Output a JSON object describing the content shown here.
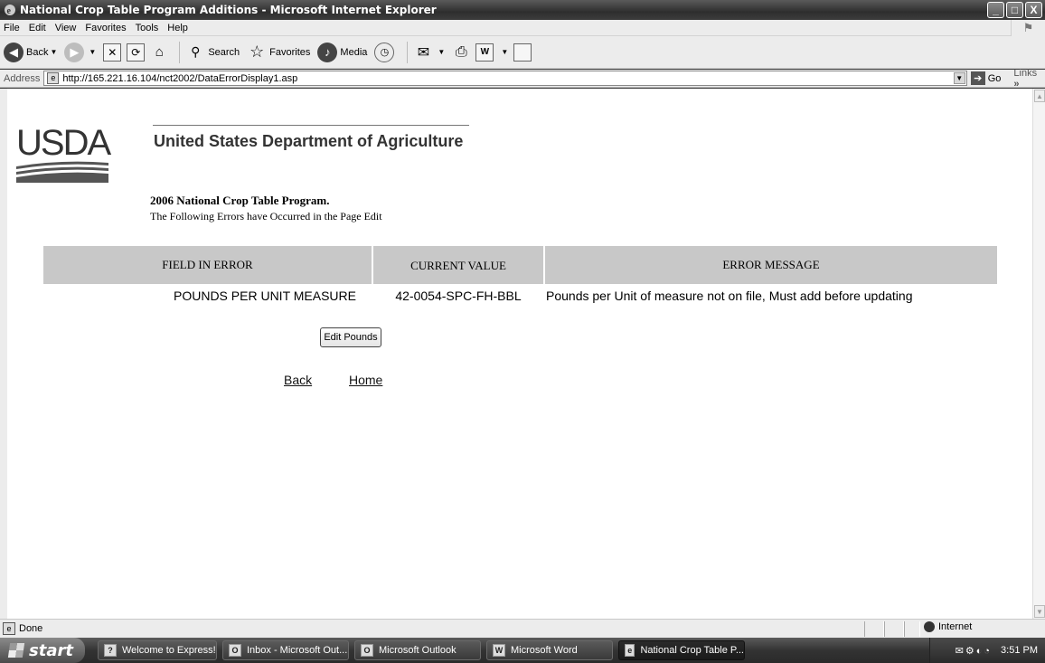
{
  "window": {
    "title": "National Crop Table Program Additions - Microsoft Internet Explorer",
    "controls": [
      "_",
      "□",
      "X"
    ]
  },
  "menu": [
    "File",
    "Edit",
    "View",
    "Favorites",
    "Tools",
    "Help"
  ],
  "toolbar": {
    "back": "Back",
    "search": "Search",
    "favorites": "Favorites",
    "media": "Media"
  },
  "address": {
    "label": "Address",
    "url": "http://165.221.16.104/nct2002/DataErrorDisplay1.asp",
    "go": "Go",
    "links": "Links"
  },
  "page": {
    "logo_text": "USDA",
    "department": "United States Department of Agriculture",
    "program_title": "2006 National Crop Table Program.",
    "subtitle": "The Following Errors have Occurred in the Page Edit",
    "table": {
      "headers": [
        "FIELD IN ERROR",
        "CURRENT VALUE",
        "ERROR MESSAGE"
      ],
      "rows": [
        {
          "field": "POUNDS PER UNIT MEASURE",
          "value": "42-0054-SPC-FH-BBL",
          "message": "Pounds per Unit of measure not on file, Must add before updating"
        }
      ]
    },
    "edit_button": "Edit Pounds",
    "back_link": "Back",
    "home_link": "Home"
  },
  "status": {
    "text": "Done",
    "zone": "Internet"
  },
  "taskbar": {
    "start": "start",
    "tasks": [
      "Welcome to Express!",
      "Inbox - Microsoft Out...",
      "Microsoft Outlook",
      "Microsoft Word",
      "National Crop Table P..."
    ],
    "clock": "3:51 PM"
  },
  "colors": {
    "table_header_bg": "#c8c8c8",
    "titlebar": "#3c3c3c"
  }
}
